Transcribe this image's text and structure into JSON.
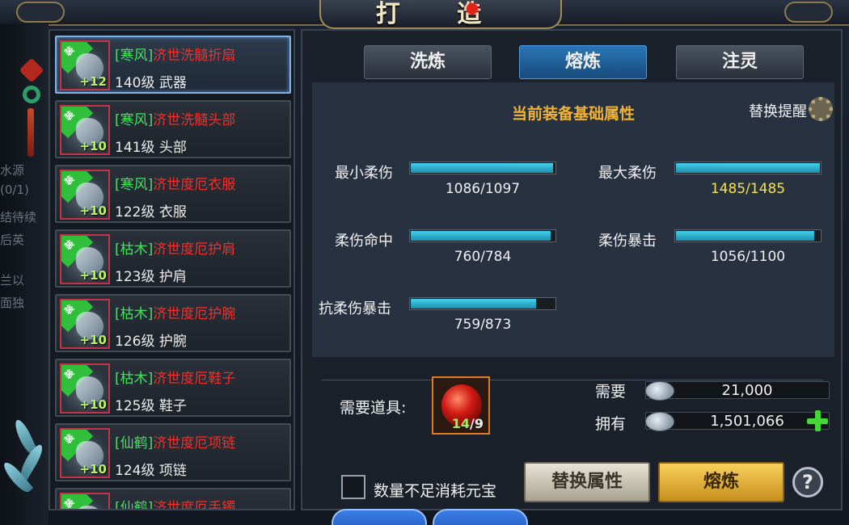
{
  "window": {
    "title": "打 造"
  },
  "side_bg_text": [
    "水源",
    "(0/1)",
    "结待续",
    "后英",
    "兰以",
    "面独"
  ],
  "equipment_list": [
    {
      "tag": "[寒风]",
      "name": "济世洗髓折扇",
      "level": "140级 武器",
      "plus": "+12",
      "equip_badge": "装",
      "selected": true
    },
    {
      "tag": "[寒风]",
      "name": "济世洗髓头部",
      "level": "141级 头部",
      "plus": "+10",
      "equip_badge": "装",
      "selected": false
    },
    {
      "tag": "[寒风]",
      "name": "济世度厄衣服",
      "level": "122级 衣服",
      "plus": "+10",
      "equip_badge": "装",
      "selected": false
    },
    {
      "tag": "[枯木]",
      "name": "济世度厄护肩",
      "level": "123级 护肩",
      "plus": "+10",
      "equip_badge": "装",
      "selected": false
    },
    {
      "tag": "[枯木]",
      "name": "济世度厄护腕",
      "level": "126级 护腕",
      "plus": "+10",
      "equip_badge": "装",
      "selected": false
    },
    {
      "tag": "[枯木]",
      "name": "济世度厄鞋子",
      "level": "125级 鞋子",
      "plus": "+10",
      "equip_badge": "装",
      "selected": false
    },
    {
      "tag": "[仙鹤]",
      "name": "济世度厄项链",
      "level": "124级 项链",
      "plus": "+10",
      "equip_badge": "装",
      "selected": false
    },
    {
      "tag": "[仙鹤]",
      "name": "济世度厄手镯",
      "level": "",
      "plus": "",
      "equip_badge": "装",
      "selected": false
    }
  ],
  "tabs": [
    {
      "label": "洗炼",
      "active": false
    },
    {
      "label": "熔炼",
      "active": true
    },
    {
      "label": "注灵",
      "active": false
    }
  ],
  "attributes": {
    "title": "当前装备基础属性",
    "replace_remind": "替换提醒",
    "stats": [
      {
        "label": "最小柔伤",
        "value": "1086/1097",
        "fill": 0.99
      },
      {
        "label": "最大柔伤",
        "value": "1485/1485",
        "fill": 1.0
      },
      {
        "label": "柔伤命中",
        "value": "760/784",
        "fill": 0.97
      },
      {
        "label": "柔伤暴击",
        "value": "1056/1100",
        "fill": 0.96
      },
      {
        "label": "抗柔伤暴击",
        "value": "759/873",
        "fill": 0.87
      }
    ]
  },
  "materials": {
    "label": "需要道具:",
    "item_have": "14",
    "item_need": "/9"
  },
  "resources": {
    "need_label": "需要",
    "need_value": "21,000",
    "own_label": "拥有",
    "own_value": "1,501,066"
  },
  "controls": {
    "checkbox_label": "数量不足消耗元宝",
    "replace_button": "替换属性",
    "smelt_button": "熔炼",
    "help": "?"
  },
  "colors": {
    "accent_blue": "#2a76b8",
    "title_gold": "#f2b233",
    "item_red": "#f0302a",
    "tag_green": "#44e060",
    "bar_cyan": "#45d0ea",
    "max_yellow": "#f5e346"
  }
}
